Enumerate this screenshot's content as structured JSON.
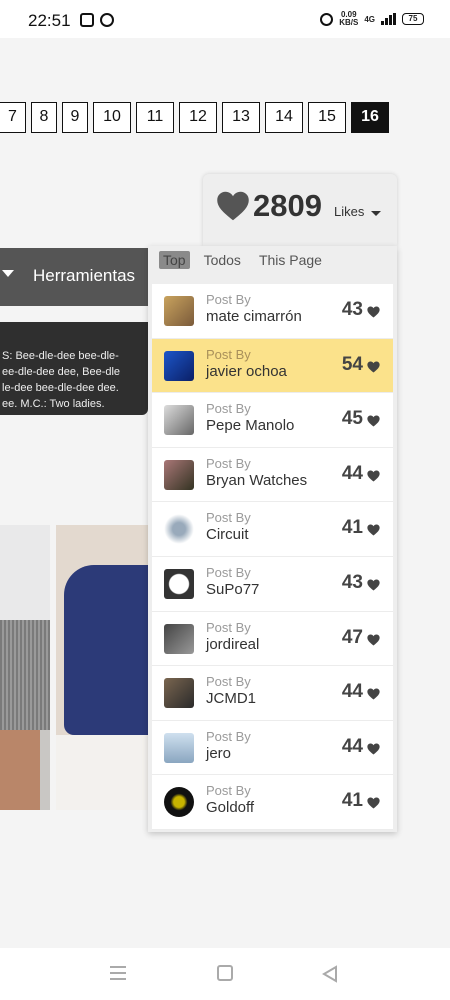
{
  "status_bar": {
    "time": "22:51",
    "net_speed_value": "0.09",
    "net_speed_unit": "KB/S",
    "network": "4G",
    "battery": "75"
  },
  "pagination": {
    "pages": [
      "7",
      "8",
      "9",
      "10",
      "11",
      "12",
      "13",
      "14",
      "15",
      "16"
    ],
    "active_page": "16"
  },
  "toolbar": {
    "tools_label": "Herramientas"
  },
  "lyrics": {
    "lines": [
      "S: Bee-dle-dee bee-dle-",
      "ee-dle-dee dee, Bee-dle",
      "le-dee bee-dle-dee dee.",
      "ee. M.C.: Two ladies."
    ]
  },
  "likes": {
    "count": "2809",
    "label": "Likes",
    "tabs": [
      "Top",
      "Todos",
      "This Page"
    ],
    "active_tab": "Top",
    "post_by_label": "Post By",
    "entries": [
      {
        "author": "mate cimarrón",
        "score": "43",
        "highlighted": false
      },
      {
        "author": "javier ochoa",
        "score": "54",
        "highlighted": true
      },
      {
        "author": "Pepe Manolo",
        "score": "45",
        "highlighted": false
      },
      {
        "author": "Bryan Watches",
        "score": "44",
        "highlighted": false
      },
      {
        "author": "Circuit",
        "score": "41",
        "highlighted": false
      },
      {
        "author": "SuPo77",
        "score": "43",
        "highlighted": false
      },
      {
        "author": "jordireal",
        "score": "47",
        "highlighted": false
      },
      {
        "author": "JCMD1",
        "score": "44",
        "highlighted": false
      },
      {
        "author": "jero",
        "score": "44",
        "highlighted": false
      },
      {
        "author": "Goldoff",
        "score": "41",
        "highlighted": false
      }
    ]
  },
  "colors": {
    "highlight": "#fbe28b",
    "dark_bar": "#555555",
    "active_page": "#111111"
  },
  "icons": {
    "likes": "heart-icon",
    "nav": [
      "menu-icon",
      "home-icon",
      "back-icon"
    ]
  }
}
